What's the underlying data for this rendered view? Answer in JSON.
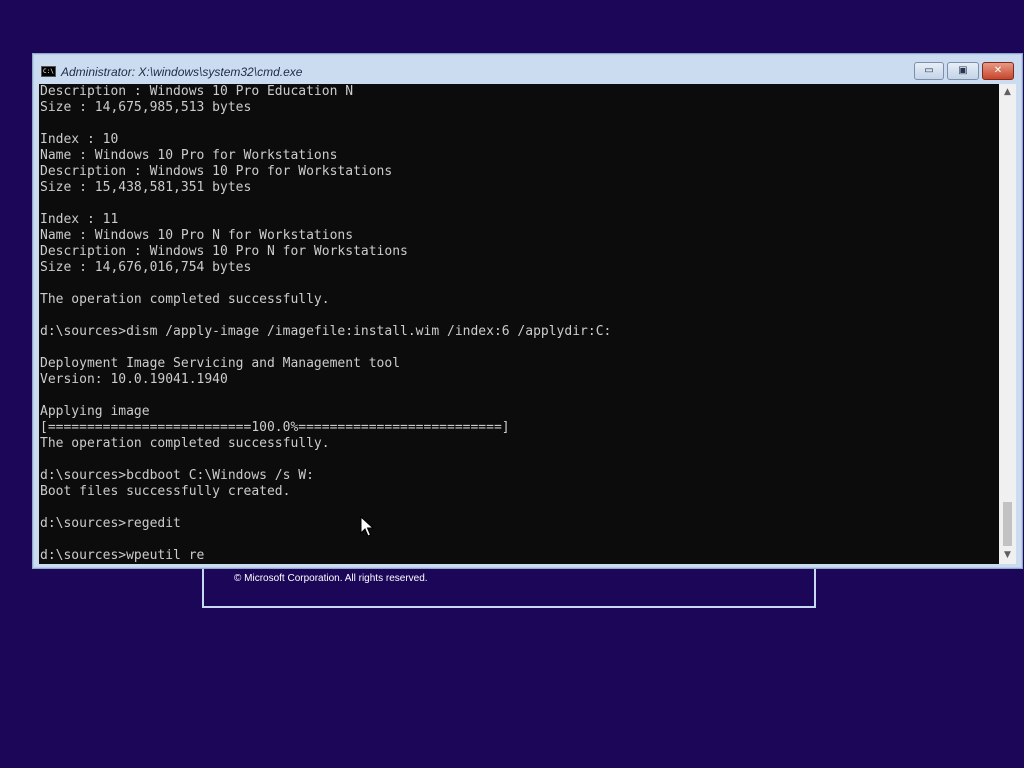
{
  "window": {
    "title": "Administrator: X:\\windows\\system32\\cmd.exe",
    "icon_label": "C:\\",
    "minimize_glyph": "▭",
    "maximize_glyph": "▣",
    "close_glyph": "✕"
  },
  "console": {
    "lines": [
      "Description : Windows 10 Pro Education N",
      "Size : 14,675,985,513 bytes",
      "",
      "Index : 10",
      "Name : Windows 10 Pro for Workstations",
      "Description : Windows 10 Pro for Workstations",
      "Size : 15,438,581,351 bytes",
      "",
      "Index : 11",
      "Name : Windows 10 Pro N for Workstations",
      "Description : Windows 10 Pro N for Workstations",
      "Size : 14,676,016,754 bytes",
      "",
      "The operation completed successfully.",
      "",
      "d:\\sources>dism /apply-image /imagefile:install.wim /index:6 /applydir:C:",
      "",
      "Deployment Image Servicing and Management tool",
      "Version: 10.0.19041.1940",
      "",
      "Applying image",
      "[==========================100.0%==========================]",
      "The operation completed successfully.",
      "",
      "d:\\sources>bcdboot C:\\Windows /s W:",
      "Boot files successfully created.",
      "",
      "d:\\sources>regedit",
      "",
      "d:\\sources>wpeutil re"
    ]
  },
  "scrollbar": {
    "up_glyph": "▲",
    "down_glyph": "▼"
  },
  "setup": {
    "copyright": "© Microsoft Corporation. All rights reserved."
  },
  "colors": {
    "desktop": "#1b0657",
    "console_bg": "#0c0c0c",
    "console_text": "#cccccc",
    "window_frame": "#ccdcf0",
    "close_button": "#c8452c"
  }
}
